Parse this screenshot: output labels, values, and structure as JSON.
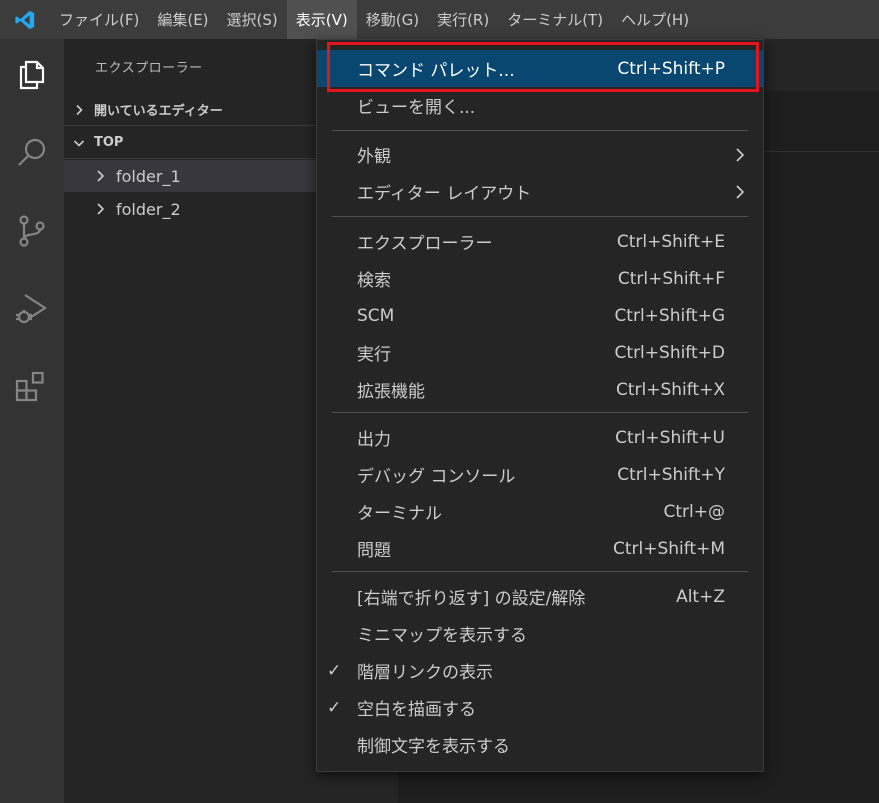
{
  "menubar": {
    "items": [
      {
        "label": "ファイル(F)"
      },
      {
        "label": "編集(E)"
      },
      {
        "label": "選択(S)"
      },
      {
        "label": "表示(V)"
      },
      {
        "label": "移動(G)"
      },
      {
        "label": "実行(R)"
      },
      {
        "label": "ターミナル(T)"
      },
      {
        "label": "ヘルプ(H)"
      }
    ],
    "active_index": 3
  },
  "activity_bar": {
    "icons": [
      "files-icon",
      "search-icon",
      "source-control-icon",
      "run-debug-icon",
      "extensions-icon"
    ]
  },
  "sidebar": {
    "title": "エクスプローラー",
    "open_editors_label": "開いているエディター",
    "workspace_label": "TOP",
    "folders": [
      {
        "label": "folder_1"
      },
      {
        "label": "folder_2"
      }
    ]
  },
  "view_menu": {
    "items": {
      "command_palette": {
        "label": "コマンド パレット...",
        "shortcut": "Ctrl+Shift+P"
      },
      "open_view": {
        "label": "ビューを開く..."
      },
      "appearance": {
        "label": "外観"
      },
      "editor_layout": {
        "label": "エディター レイアウト"
      },
      "explorer": {
        "label": "エクスプローラー",
        "shortcut": "Ctrl+Shift+E"
      },
      "search": {
        "label": "検索",
        "shortcut": "Ctrl+Shift+F"
      },
      "scm": {
        "label": "SCM",
        "shortcut": "Ctrl+Shift+G"
      },
      "run": {
        "label": "実行",
        "shortcut": "Ctrl+Shift+D"
      },
      "extensions": {
        "label": "拡張機能",
        "shortcut": "Ctrl+Shift+X"
      },
      "output": {
        "label": "出力",
        "shortcut": "Ctrl+Shift+U"
      },
      "debug_console": {
        "label": "デバッグ コンソール",
        "shortcut": "Ctrl+Shift+Y"
      },
      "terminal": {
        "label": "ターミナル",
        "shortcut": "Ctrl+@"
      },
      "problems": {
        "label": "問題",
        "shortcut": "Ctrl+Shift+M"
      },
      "word_wrap": {
        "label": "[右端で折り返す] の設定/解除",
        "shortcut": "Alt+Z"
      },
      "minimap": {
        "label": "ミニマップを表示する"
      },
      "breadcrumbs": {
        "label": "階層リンクの表示",
        "checked": true,
        "check_glyph": "✓"
      },
      "render_whitespace": {
        "label": "空白を描画する",
        "checked": true,
        "check_glyph": "✓"
      },
      "render_control_chars": {
        "label": "制御文字を表示する"
      }
    }
  },
  "colors": {
    "menubar_bg": "#3c3c3c",
    "activity_bar_bg": "#333333",
    "sidebar_bg": "#252526",
    "highlight_bg": "#094771",
    "annotation_box": "#e3141b",
    "vscode_blue": "#23a9f2"
  }
}
